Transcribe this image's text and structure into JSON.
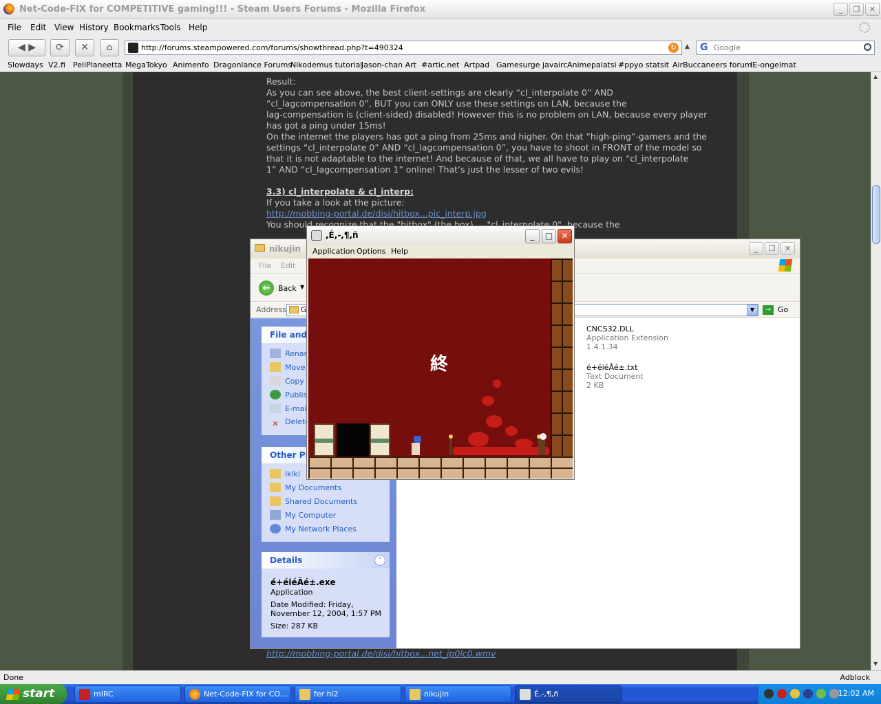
{
  "firefox": {
    "title": "Net-Code-FIX for COMPETITIVE gaming!!! - Steam Users Forums - Mozilla Firefox",
    "menu": [
      "File",
      "Edit",
      "View",
      "History",
      "Bookmarks",
      "Tools",
      "Help"
    ],
    "url": "http://forums.steampowered.com/forums/showthread.php?t=490324",
    "search_placeholder": "Google",
    "bookmarks": [
      "Slowdays",
      "V2.fi",
      "PeliPlaneetta",
      "MegaTokyo",
      "Animenfo",
      "Dragonlance Forums",
      "Nikodemus tutorial",
      "Jason-chan Art",
      "#artic.net",
      "Artpad",
      "Gamesurge javairc",
      "Animepalatsi",
      "#ppyo statsit",
      "AirBuccaneers forum",
      "IE-ongelmat"
    ],
    "status_left": "Done",
    "status_right": "Adblock"
  },
  "article": {
    "lines": [
      "Result:",
      "As you can see above, the best client-settings are clearly “cl_interpolate 0” AND",
      "“cl_lagcompensation 0”, BUT you can ONLY use these settings on LAN, because the",
      "lag-compensation is (client-sided) disabled! However this is no problem on LAN, because every player",
      "has got a ping under 15ms!",
      "On the internet the players has got a ping from 25ms and higher. On that “high-ping”-gamers and the",
      "settings “cl_interpolate 0” AND “cl_lagcompensation 0”, you have to shoot in FRONT of the model so",
      "that it is not adaptable to the internet! And because of that, we all have to play on “cl_interpolate",
      "1” AND “cl_lagcompensation 1” online! That’s just the lesser of two evils!"
    ],
    "section_header": "3.3) cl_interpolate & cl_interp:",
    "line_after_header": "If you take a look at the picture:",
    "link1": "http://mobbing-portal.de/disi/hitbox...pic_interp.jpg",
    "partial_line": "You should recognize that the \"hitbox\" (the box) ... \"cl_interpolate 0\", because the",
    "bottom_link": "http://mobbing-portal.de/disi/hitbox...net_ip0lc0.wmv"
  },
  "explorer": {
    "title": "nikujin",
    "menu": [
      "File",
      "Edit"
    ],
    "back_label": "Back",
    "address_label": "Address",
    "address_value": "G",
    "go_label": "Go",
    "tasks_header": "File and F",
    "tasks": [
      "Renar",
      "Move",
      "Copy",
      "Publis",
      "E-mail",
      "Delete"
    ],
    "other_header": "Other Pla",
    "other_places": [
      "ikiki",
      "My Documents",
      "Shared Documents",
      "My Computer",
      "My Network Places"
    ],
    "details_header": "Details",
    "details": {
      "name": "é+éiéÂé±.exe",
      "type": "Application",
      "modified": "Date Modified: Friday,",
      "modified2": "November 12, 2004, 1:57 PM",
      "size": "Size: 287 KB"
    },
    "files": [
      {
        "name": "CNCS32.DLL",
        "type": "Application Extension",
        "meta": "1.4.1.34"
      },
      {
        "name": "é+éiéÂé±.txt",
        "type": "Text Document",
        "meta": "2 KB"
      }
    ]
  },
  "game": {
    "title": ",É,-,¶,ñ",
    "menu": [
      "Application",
      "Options",
      "Help"
    ],
    "end_text": "終"
  },
  "taskbar": {
    "start_label": "start",
    "tasks": [
      "mIRC",
      "Net-Code-FIX for CO...",
      "fer hl2",
      "nikujin",
      "É,-,¶,ñ"
    ],
    "clock": "12:02 AM"
  },
  "colors": {
    "page_bg": "#4c5844",
    "content_bg": "#2d2d2d",
    "link": "#6a8fd0",
    "game_bg": "#750e0c",
    "xp_blue": "#2457d6"
  }
}
